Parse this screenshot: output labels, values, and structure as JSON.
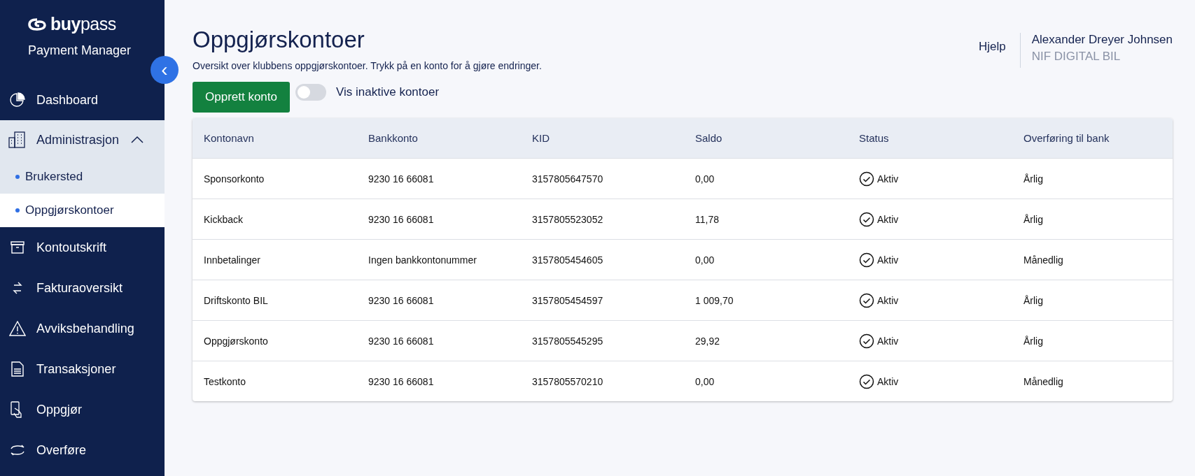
{
  "sidebar": {
    "logo": {
      "brand_bold": "buy",
      "brand_light": "pass"
    },
    "product": "Payment Manager",
    "collapse_button": "‹",
    "items": [
      {
        "label": "Dashboard",
        "selected": false
      },
      {
        "label": "Administrasjon",
        "selected": false,
        "expanded": true,
        "children": [
          {
            "label": "Brukersted",
            "selected": false
          },
          {
            "label": "Oppgjørskontoer",
            "selected": true
          }
        ]
      },
      {
        "label": "Kontoutskrift",
        "selected": false
      },
      {
        "label": "Fakturaoversikt",
        "selected": false
      },
      {
        "label": "Avviksbehandling",
        "selected": false
      },
      {
        "label": "Transaksjoner",
        "selected": false
      },
      {
        "label": "Oppgjør",
        "selected": false
      },
      {
        "label": "Overføre",
        "selected": false
      }
    ]
  },
  "header": {
    "title": "Oppgjørskontoer",
    "subtitle": "Oversikt over klubbens oppgjørskontoer. Trykk på en konto for å gjøre endringer.",
    "help": "Hjelp",
    "user": {
      "name": "Alexander Dreyer Johnsen",
      "organization": "NIF DIGITAL BIL"
    }
  },
  "actions": {
    "create_button": "Opprett konto",
    "toggle": {
      "label": "Vis inaktive kontoer",
      "on": false
    }
  },
  "table": {
    "columns": [
      "Kontonavn",
      "Bankkonto",
      "KID",
      "Saldo",
      "Status",
      "Overføring til bank"
    ],
    "rows": [
      {
        "name": "Sponsorkonto",
        "bank_account": "9230 16 66081",
        "kid": "3157805647570",
        "balance": "0,00",
        "status": "Aktiv",
        "transfer": "Årlig"
      },
      {
        "name": "Kickback",
        "bank_account": "9230 16 66081",
        "kid": "3157805523052",
        "balance": "11,78",
        "status": "Aktiv",
        "transfer": "Årlig"
      },
      {
        "name": "Innbetalinger",
        "bank_account": "Ingen bankkontonummer",
        "kid": "3157805454605",
        "balance": "0,00",
        "status": "Aktiv",
        "transfer": "Månedlig"
      },
      {
        "name": "Driftskonto BIL",
        "bank_account": "9230 16 66081",
        "kid": "3157805454597",
        "balance": "1 009,70",
        "status": "Aktiv",
        "transfer": "Årlig"
      },
      {
        "name": "Oppgjørskonto",
        "bank_account": "9230 16 66081",
        "kid": "3157805545295",
        "balance": "29,92",
        "status": "Aktiv",
        "transfer": "Årlig"
      },
      {
        "name": "Testkonto",
        "bank_account": "9230 16 66081",
        "kid": "3157805570210",
        "balance": "0,00",
        "status": "Aktiv",
        "transfer": "Månedlig"
      }
    ]
  }
}
